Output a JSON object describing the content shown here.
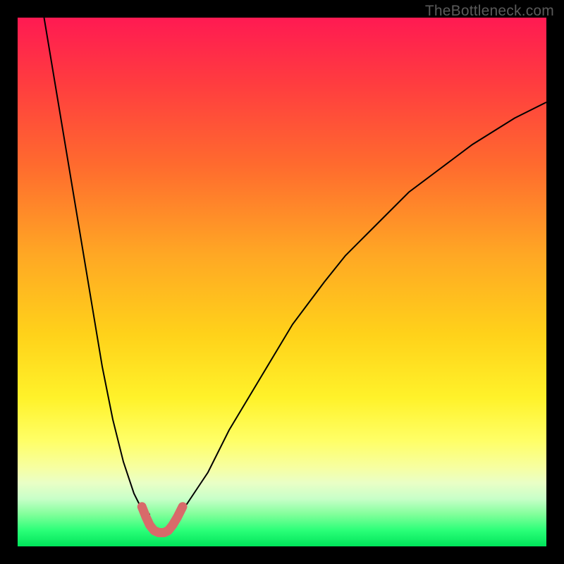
{
  "watermark": {
    "text": "TheBottleneck.com"
  },
  "chart_data": {
    "type": "line",
    "title": "",
    "xlabel": "",
    "ylabel": "",
    "xlim": [
      0,
      100
    ],
    "ylim": [
      0,
      100
    ],
    "background_gradient_stops": [
      {
        "pct": 0,
        "color": "#ff1a52"
      },
      {
        "pct": 12,
        "color": "#ff3b40"
      },
      {
        "pct": 28,
        "color": "#ff6b2e"
      },
      {
        "pct": 45,
        "color": "#ffa824"
      },
      {
        "pct": 60,
        "color": "#ffd21a"
      },
      {
        "pct": 72,
        "color": "#fff22a"
      },
      {
        "pct": 80,
        "color": "#ffff66"
      },
      {
        "pct": 85,
        "color": "#f7ffa0"
      },
      {
        "pct": 88,
        "color": "#e9ffc6"
      },
      {
        "pct": 91,
        "color": "#c8ffc8"
      },
      {
        "pct": 94,
        "color": "#80ff9a"
      },
      {
        "pct": 97,
        "color": "#2aff78"
      },
      {
        "pct": 100,
        "color": "#00e45a"
      }
    ],
    "series": [
      {
        "name": "left-branch",
        "color": "#000000",
        "stroke_width": 2,
        "x": [
          5,
          6,
          7,
          8,
          9,
          10,
          11,
          12,
          13,
          14,
          15,
          16,
          17,
          18,
          19,
          20,
          21,
          22,
          23,
          24,
          25
        ],
        "y": [
          100,
          94,
          88,
          82,
          76,
          70,
          64,
          58,
          52,
          46,
          40,
          34,
          29,
          24,
          20,
          16,
          13,
          10,
          8,
          7,
          6
        ]
      },
      {
        "name": "right-branch",
        "color": "#000000",
        "stroke_width": 2,
        "x": [
          30,
          32,
          34,
          36,
          38,
          40,
          43,
          46,
          49,
          52,
          55,
          58,
          62,
          66,
          70,
          74,
          78,
          82,
          86,
          90,
          94,
          98,
          100
        ],
        "y": [
          6,
          8,
          11,
          14,
          18,
          22,
          27,
          32,
          37,
          42,
          46,
          50,
          55,
          59,
          63,
          67,
          70,
          73,
          76,
          78.5,
          81,
          83,
          84
        ]
      },
      {
        "name": "bottom-well",
        "color": "#d86a6a",
        "stroke_width": 13,
        "linecap": "round",
        "x": [
          23.5,
          24.3,
          25,
          25.8,
          26.7,
          27.7,
          28.5,
          29.3,
          30.2,
          31.2
        ],
        "y": [
          7.5,
          5.5,
          4.0,
          3.0,
          2.6,
          2.6,
          3.0,
          4.0,
          5.5,
          7.5
        ]
      }
    ]
  }
}
